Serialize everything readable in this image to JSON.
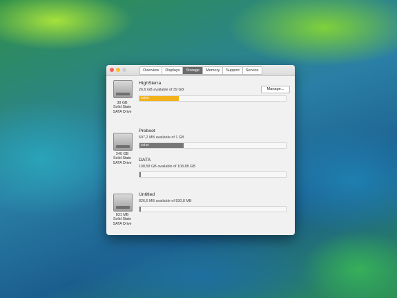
{
  "window": {
    "tabs": [
      "Overview",
      "Displays",
      "Storage",
      "Memory",
      "Support",
      "Service"
    ],
    "active_tab_index": 2
  },
  "manage_label": "Manage...",
  "drives": [
    {
      "size": "39 GB",
      "type_line1": "Solid State",
      "type_line2": "SATA Drive",
      "volumes": [
        {
          "name": "HighSierra",
          "available": "26,6 GB available of 39 GB",
          "bar_label": "Other",
          "bar_color": "#f2b21b",
          "used_fraction": 0.27
        }
      ]
    },
    {
      "size": "240 GB",
      "type_line1": "Solid State",
      "type_line2": "SATA Drive",
      "volumes": [
        {
          "name": "Preboot",
          "available": "697,2 MB available of 1 GB",
          "bar_label": "Other",
          "bar_color": "#777777",
          "used_fraction": 0.3
        },
        {
          "name": "DATA",
          "available": "108,58 GB available of 108,88 GB",
          "bar_label": "",
          "bar_color": "#777777",
          "used_fraction": 0.0
        }
      ]
    },
    {
      "size": "831 MB",
      "type_line1": "Solid State",
      "type_line2": "SATA Drive",
      "volumes": [
        {
          "name": "Untitled",
          "available": "826,6 MB available of 830,8 MB",
          "bar_label": "",
          "bar_color": "#777777",
          "used_fraction": 0.0
        }
      ]
    }
  ]
}
